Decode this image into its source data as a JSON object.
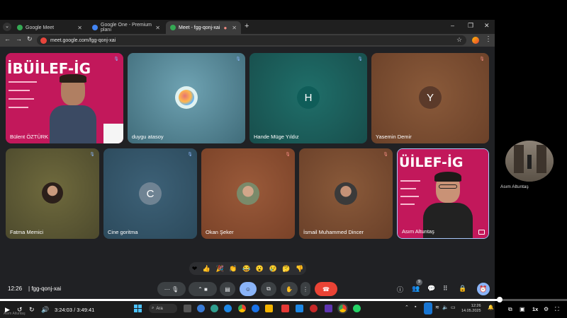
{
  "browser": {
    "tabs": [
      {
        "label": "Google Meet"
      },
      {
        "label": "Google One - Premium planı"
      },
      {
        "label": "Meet - fgg-qonj-xai"
      }
    ],
    "url": "meet.google.com/fgg-qonj-xai"
  },
  "tiles": [
    {
      "name": "Bülent ÖZTÜRK",
      "mic": "on",
      "kind": "slide",
      "slide_title": "İBÜİLEF-İG"
    },
    {
      "name": "duygu atasoy",
      "mic": "on",
      "kind": "photo-avatar"
    },
    {
      "name": "Hande Müge Yıldız",
      "mic": "on",
      "kind": "letter",
      "letter": "H"
    },
    {
      "name": "Yasemin Demir",
      "mic": "muted",
      "kind": "letter",
      "letter": "Y"
    },
    {
      "name": "Fatma Memici",
      "mic": "on",
      "kind": "photo-avatar"
    },
    {
      "name": "Cine goritma",
      "mic": "on",
      "kind": "letter",
      "letter": "C"
    },
    {
      "name": "Okan Şeker",
      "mic": "muted",
      "kind": "photo-avatar"
    },
    {
      "name": "İsmail Muhammed Dincer",
      "mic": "muted",
      "kind": "photo-avatar"
    },
    {
      "name": "Asım Altuntaş",
      "mic": "on",
      "kind": "slide",
      "slide_title": "ÜİLEF-İG"
    }
  ],
  "reactions": [
    "❤",
    "👍",
    "🎉",
    "👏",
    "😂",
    "😮",
    "😢",
    "🤔",
    "👎"
  ],
  "meeting": {
    "time": "12:26",
    "code": "fgg-qonj-xai",
    "people_count": "9"
  },
  "taskbar": {
    "search_label": "Ara",
    "clock_time": "12:26",
    "clock_date": "14.05.2025"
  },
  "side_participant": {
    "name": "Asım Altuntaş"
  },
  "player": {
    "time": "3:24:03 / 3:49:41",
    "speed": "1x",
    "progress": 0.881,
    "watermark": "Asım Altuntaş"
  },
  "colors": {
    "meet_bg": "#202124",
    "hangup": "#ea4335",
    "accent": "#8ab4f8",
    "slide_pink": "#c2185b"
  }
}
